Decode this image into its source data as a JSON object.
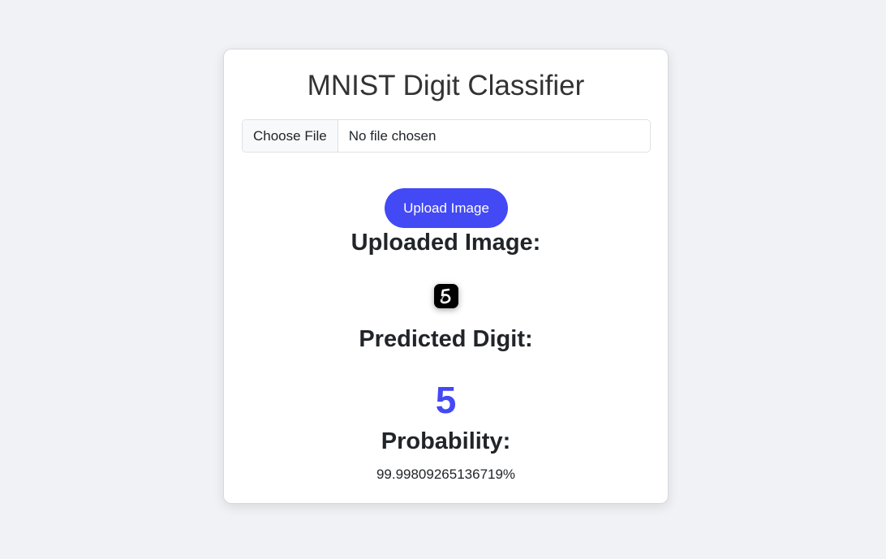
{
  "app": {
    "title": "MNIST Digit Classifier"
  },
  "file_input": {
    "button_label": "Choose File",
    "status": "No file chosen"
  },
  "upload": {
    "button_label": "Upload Image"
  },
  "result": {
    "uploaded_heading": "Uploaded Image:",
    "predicted_heading": "Predicted Digit:",
    "predicted_digit": "5",
    "probability_heading": "Probability:",
    "probability_value": "99.99809265136719%"
  },
  "colors": {
    "accent": "#4349f5",
    "background": "#f0f2f5",
    "card": "#ffffff"
  }
}
